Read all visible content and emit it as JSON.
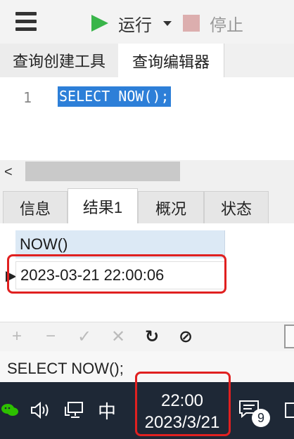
{
  "toolbar": {
    "run_label": "运行",
    "stop_label": "停止"
  },
  "top_tabs": [
    "查询创建工具",
    "查询编辑器"
  ],
  "editor": {
    "line_number": "1",
    "sql": "SELECT NOW();"
  },
  "result_tabs": [
    "信息",
    "结果1",
    "概况",
    "状态"
  ],
  "grid": {
    "column": "NOW()",
    "value": "2023-03-21 22:00:06",
    "row_marker": "▶"
  },
  "grid_toolbar": {
    "add": "+",
    "remove": "−",
    "apply": "✓",
    "discard": "✕",
    "refresh": "↻",
    "stop": "⊘"
  },
  "status": {
    "sql": "SELECT NOW();"
  },
  "taskbar": {
    "ime": "中",
    "time": "22:00",
    "date": "2023/3/21",
    "notification_count": "9"
  },
  "colors": {
    "run_green": "#39b54a",
    "selection_blue": "#2d7fd8",
    "highlight_red": "#e02020",
    "taskbar": "#1e2836"
  }
}
